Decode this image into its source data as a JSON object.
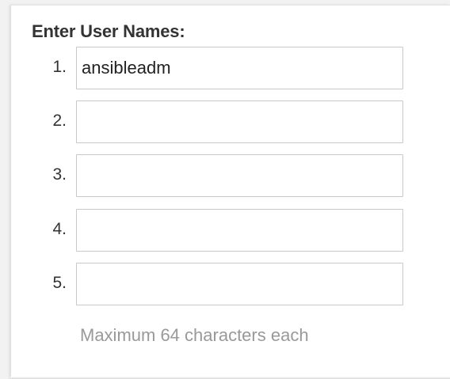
{
  "form": {
    "heading": "Enter User Names:",
    "rows": [
      {
        "number": "1.",
        "value": "ansibleadm",
        "placeholder": ""
      },
      {
        "number": "2.",
        "value": "",
        "placeholder": ""
      },
      {
        "number": "3.",
        "value": "",
        "placeholder": ""
      },
      {
        "number": "4.",
        "value": "",
        "placeholder": ""
      },
      {
        "number": "5.",
        "value": "",
        "placeholder": ""
      }
    ],
    "hint": "Maximum 64 characters each"
  },
  "colors": {
    "heading_text": "#333333",
    "hint_text": "#999999",
    "input_border": "#c9c9c9"
  }
}
